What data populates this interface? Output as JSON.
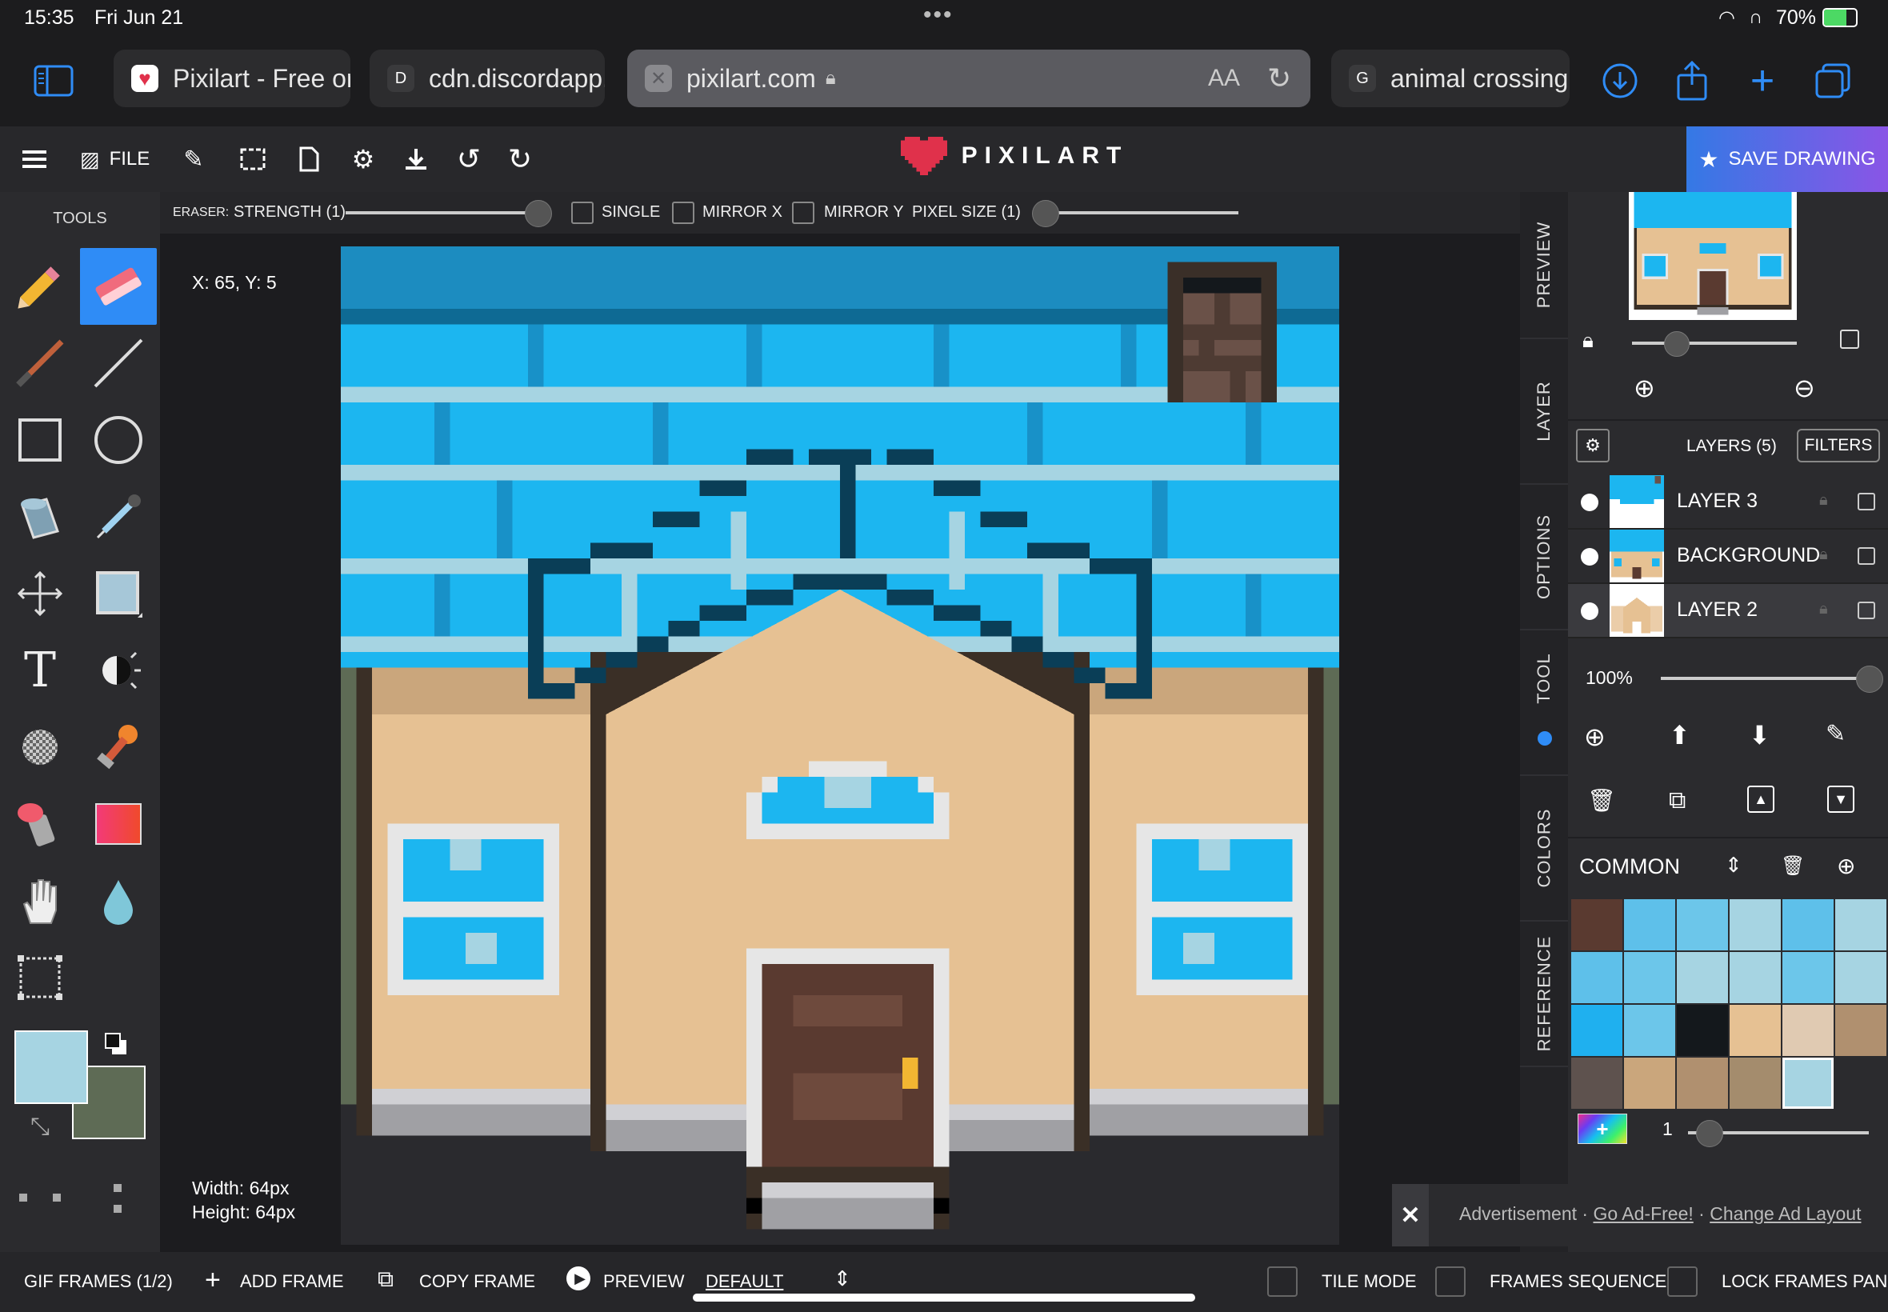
{
  "status": {
    "time": "15:35",
    "date": "Fri Jun 21",
    "dots": "•••",
    "battery": "70%"
  },
  "browser": {
    "tabs": [
      {
        "label": "Pixilart - Free or",
        "favicon": "heart-icon"
      },
      {
        "label": "cdn.discordapp.",
        "favicon": "D"
      },
      {
        "label": "pixilart.com",
        "favicon": "close-icon",
        "active": true
      },
      {
        "label": "animal crossing",
        "favicon": "G"
      }
    ],
    "reader_label": "AA"
  },
  "toolbar": {
    "file_label": "FILE",
    "logo_text": "PIXILART",
    "save_label": "SAVE DRAWING"
  },
  "tools": {
    "title": "TOOLS",
    "selected": "eraser",
    "primary_color": "#a6d4e2",
    "secondary_color": "#5e6b55"
  },
  "options": {
    "tool_label": "ERASER:",
    "strength_label": "STRENGTH (1)",
    "single_label": "SINGLE",
    "mirror_x_label": "MIRROR X",
    "mirror_y_label": "MIRROR Y",
    "pixel_size_label": "PIXEL SIZE (1)"
  },
  "canvas": {
    "coords": "X: 65, Y: 5",
    "width_label": "Width: 64px",
    "height_label": "Height: 64px"
  },
  "side_tabs": [
    "PREVIEW",
    "LAYER",
    "OPTIONS",
    "TOOL",
    "COLORS",
    "REFERENCE"
  ],
  "layers": {
    "header": "LAYERS (5)",
    "filters_label": "FILTERS",
    "items": [
      {
        "name": "LAYER 3"
      },
      {
        "name": "BACKGROUND"
      },
      {
        "name": "LAYER 2"
      }
    ],
    "opacity": "100%"
  },
  "colors": {
    "palette_name": "COMMON",
    "brush_size": "1",
    "swatches": [
      "#5a3a30",
      "#5ec0ea",
      "#6cc6ea",
      "#a6d4e2",
      "#5ec0ea",
      "#a6d4e2",
      "#5ec0ea",
      "#6cc6ea",
      "#a6d4e2",
      "#a6d4e2",
      "#6cc6ea",
      "#a6d4e2",
      "#1fb0ef",
      "#6cc6ea",
      "#14181c",
      "#e6c193",
      "#e0cab2",
      "#b0906f",
      "#5e524e",
      "#caa67c",
      "#b0906f",
      "#a48c6d",
      "#a6d4e2"
    ]
  },
  "ad": {
    "label": "Advertisement",
    "sep": "·",
    "link1": "Go Ad-Free!",
    "link2": "Change Ad Layout"
  },
  "bottom": {
    "gif_frames": "GIF FRAMES (1/2)",
    "add_frame": "ADD FRAME",
    "copy_frame": "COPY FRAME",
    "preview": "PREVIEW",
    "speed": "DEFAULT",
    "tile_mode": "TILE MODE",
    "frames_sequence": "FRAMES SEQUENCE",
    "lock_frames": "LOCK FRAMES PANEL"
  }
}
